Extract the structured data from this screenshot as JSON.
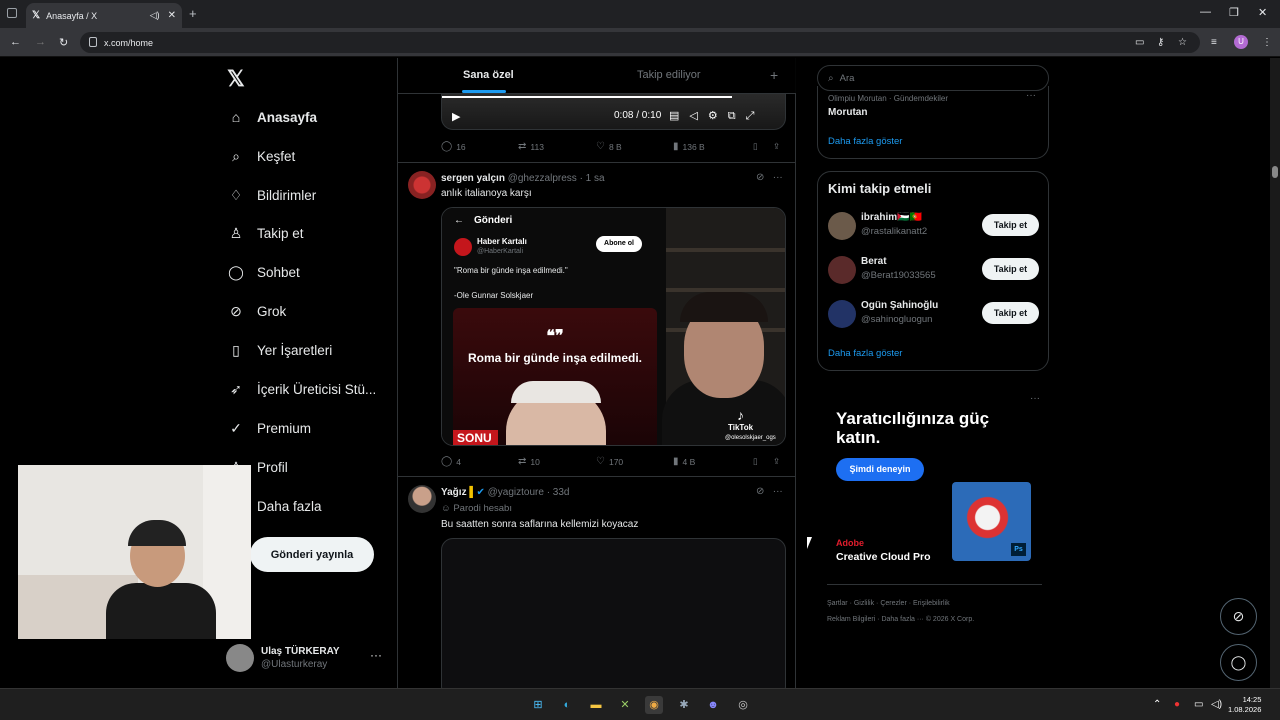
{
  "browser": {
    "tab_title": "Anasayfa / X",
    "tab_icon": "x-logo",
    "url": "x.com/home",
    "profile_initial": "U"
  },
  "nav": {
    "logo": "𝕏",
    "items": [
      {
        "label": "Anasayfa",
        "icon": "home-icon",
        "glyph": "⌂"
      },
      {
        "label": "Keşfet",
        "icon": "search-icon",
        "glyph": "⌕"
      },
      {
        "label": "Bildirimler",
        "icon": "bell-icon",
        "glyph": "♢"
      },
      {
        "label": "Takip et",
        "icon": "person-plus-icon",
        "glyph": "♙"
      },
      {
        "label": "Sohbet",
        "icon": "chat-icon",
        "glyph": "◯"
      },
      {
        "label": "Grok",
        "icon": "grok-icon",
        "glyph": "⊘"
      },
      {
        "label": "Yer İşaretleri",
        "icon": "bookmark-icon",
        "glyph": "▯"
      },
      {
        "label": "İçerik Üreticisi Stü...",
        "icon": "rocket-icon",
        "glyph": "➶"
      },
      {
        "label": "Premium",
        "icon": "premium-icon",
        "glyph": "✓"
      },
      {
        "label": "Profil",
        "icon": "profile-icon",
        "glyph": "♙"
      },
      {
        "label": "Daha fazla",
        "icon": "more-icon",
        "glyph": "⋯"
      }
    ],
    "post_button": "Gönderi yayınla",
    "account_name": "Ulaş TÜRKERAY",
    "account_handle": "@Ulasturkeray"
  },
  "feed": {
    "tabs": [
      "Sana özel",
      "Takip ediliyor"
    ],
    "video_time": "0:08 / 0:10",
    "posts": [
      {
        "stats": {
          "replies": "16",
          "reposts": "113",
          "likes": "8 B",
          "views": "136 B"
        }
      },
      {
        "name": "sergen yalçın",
        "handle": "@ghezzalpress",
        "time": "· 1 sa",
        "text": "anlık italianoya karşı",
        "embed": {
          "header": "Gönderi",
          "account": "Haber Kartalı",
          "account_handle": "@HaberKartali",
          "subscribe": "Abone ol",
          "quote": "\"Roma bir günde inşa edilmedi.\"",
          "author": "-Ole Gunnar Solskjaer",
          "big_quote_mark": "❝❞",
          "big_text": "Roma bir günde inşa edilmedi.",
          "strip": "SONU",
          "tiktok": "TikTok",
          "tiktok_user": "@olesolskjaer_ogs"
        },
        "stats": {
          "replies": "4",
          "reposts": "10",
          "likes": "170",
          "views": "4 B"
        }
      },
      {
        "name": "Yağız",
        "handle": "@yagiztoure",
        "time": "· 33d",
        "label": "Parodi hesabı",
        "text": "Bu saatten sonra saflarına kellemizi koyacaz"
      }
    ]
  },
  "sidebar": {
    "search_placeholder": "Ara",
    "trend_meta": "Olimpiu Morutan · Gündemdekiler",
    "trend_name": "Morutan",
    "show_more": "Daha fazla göster",
    "who_to_follow_title": "Kimi takip etmeli",
    "follow_button": "Takip et",
    "suggestions": [
      {
        "name": "ibrahim🇵🇸🇵🇹",
        "handle": "@rastalikanatt2",
        "avatar_color": "#6b5a4a"
      },
      {
        "name": "Berat",
        "handle": "@Berat19033565",
        "avatar_color": "#5a2a2a"
      },
      {
        "name": "Ogün Şahinoğlu",
        "handle": "@sahinogluogun",
        "avatar_color": "#223366"
      }
    ]
  },
  "ad": {
    "headline": "Yaratıcılığınıza güç katın.",
    "cta": "Şimdi deneyin",
    "brand": "Adobe",
    "product": "Creative Cloud Pro",
    "ps_badge": "Ps"
  },
  "footer": {
    "row1": [
      "Şartlar",
      "Gizlilik",
      "Çerezler",
      "Erişilebilirlik"
    ],
    "row2": [
      "Reklam Bilgileri",
      "Daha fazla ···",
      "© 2026 X Corp."
    ]
  },
  "taskbar": {
    "time": "14:25",
    "date": "1.08.2026"
  },
  "colors": {
    "accent": "#1d9bf0",
    "background": "#000000",
    "border": "#2f3336",
    "muted": "#71767b"
  }
}
